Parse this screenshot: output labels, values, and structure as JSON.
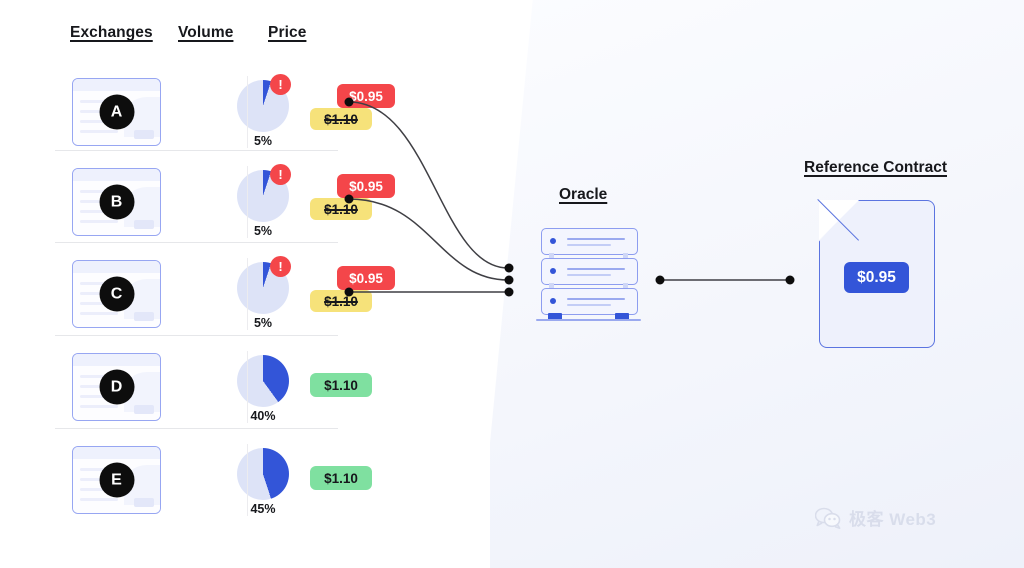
{
  "headers": {
    "exchanges": "Exchanges",
    "volume": "Volume",
    "price": "Price"
  },
  "labels": {
    "oracle": "Oracle",
    "reference_contract": "Reference Contract"
  },
  "colors": {
    "alert_red": "#f4464a",
    "warn_yellow": "#f6e27a",
    "ok_green": "#7fe0a0",
    "accent_blue": "#3355d8",
    "outline_blue": "#8d9df0",
    "ink": "#17181c"
  },
  "exchanges": [
    {
      "id": "A",
      "letter": "A",
      "volume_percent": "5%",
      "volume_value": 5,
      "alerted": true,
      "alert_glyph": "!",
      "price_old": "$1.10",
      "price_new": "$0.95",
      "price_state": "manipulated"
    },
    {
      "id": "B",
      "letter": "B",
      "volume_percent": "5%",
      "volume_value": 5,
      "alerted": true,
      "alert_glyph": "!",
      "price_old": "$1.10",
      "price_new": "$0.95",
      "price_state": "manipulated"
    },
    {
      "id": "C",
      "letter": "C",
      "volume_percent": "5%",
      "volume_value": 5,
      "alerted": true,
      "alert_glyph": "!",
      "price_old": "$1.10",
      "price_new": "$0.95",
      "price_state": "manipulated"
    },
    {
      "id": "D",
      "letter": "D",
      "volume_percent": "40%",
      "volume_value": 40,
      "alerted": false,
      "alert_glyph": "",
      "price_old": "",
      "price_new": "$1.10",
      "price_state": "normal"
    },
    {
      "id": "E",
      "letter": "E",
      "volume_percent": "45%",
      "volume_value": 45,
      "alerted": false,
      "alert_glyph": "",
      "price_old": "",
      "price_new": "$1.10",
      "price_state": "normal"
    }
  ],
  "contract": {
    "price": "$0.95"
  },
  "browser_card": {
    "code_glyph": "</>"
  },
  "watermark": {
    "text": "极客 Web3",
    "icon": "wechat-bubbles-icon"
  }
}
